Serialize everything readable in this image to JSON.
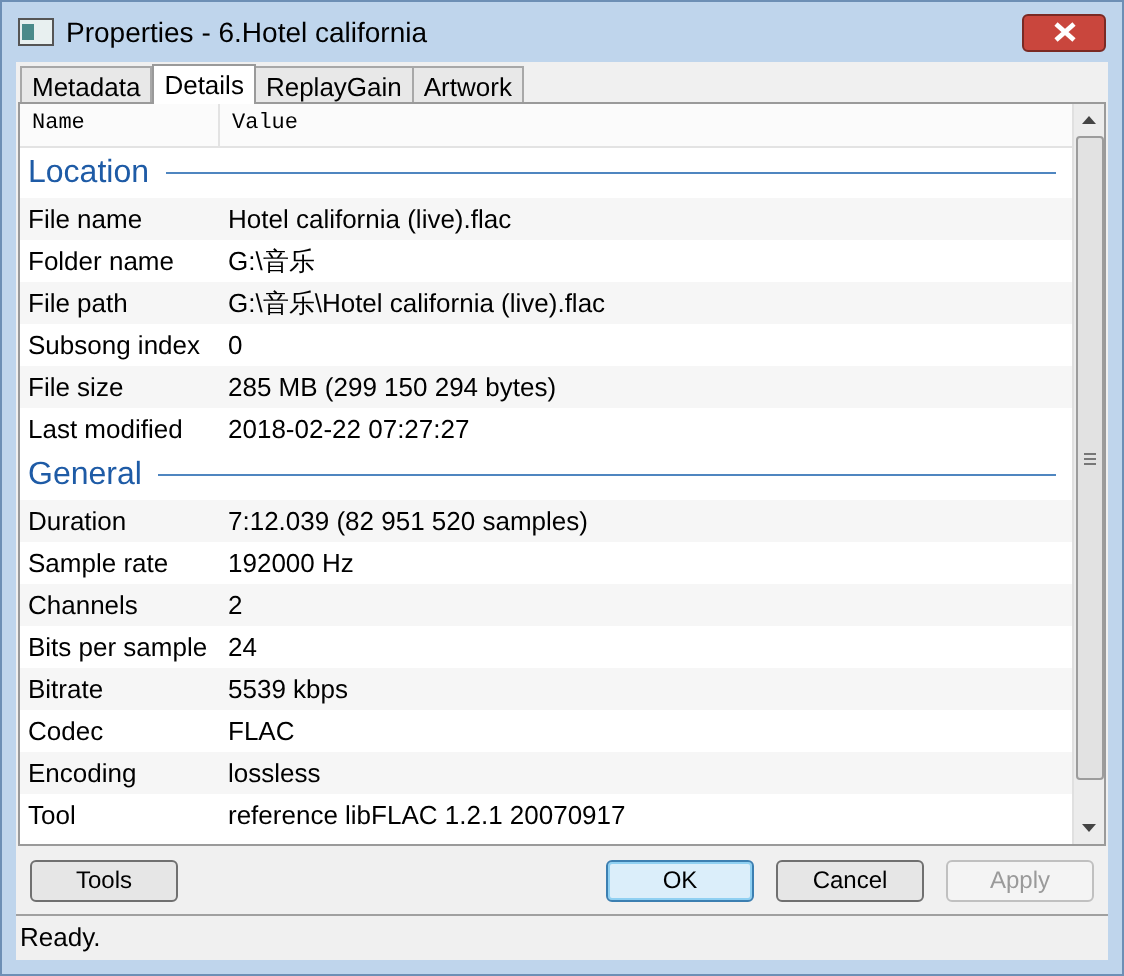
{
  "window": {
    "title": "Properties - 6.Hotel california"
  },
  "tabs": [
    {
      "label": "Metadata",
      "selected": false
    },
    {
      "label": "Details",
      "selected": true
    },
    {
      "label": "ReplayGain",
      "selected": false
    },
    {
      "label": "Artwork",
      "selected": false
    }
  ],
  "table": {
    "columns": [
      "Name",
      "Value"
    ],
    "groups": [
      {
        "title": "Location",
        "rows": [
          {
            "name": "File name",
            "value": "Hotel california (live).flac"
          },
          {
            "name": "Folder name",
            "value": "G:\\音乐"
          },
          {
            "name": "File path",
            "value": "G:\\音乐\\Hotel california (live).flac"
          },
          {
            "name": "Subsong index",
            "value": "0"
          },
          {
            "name": "File size",
            "value": "285 MB (299 150 294 bytes)"
          },
          {
            "name": "Last modified",
            "value": "2018-02-22 07:27:27"
          }
        ]
      },
      {
        "title": "General",
        "rows": [
          {
            "name": "Duration",
            "value": "7:12.039 (82 951 520 samples)"
          },
          {
            "name": "Sample rate",
            "value": "192000 Hz"
          },
          {
            "name": "Channels",
            "value": "2"
          },
          {
            "name": "Bits per sample",
            "value": "24"
          },
          {
            "name": "Bitrate",
            "value": "5539 kbps"
          },
          {
            "name": "Codec",
            "value": "FLAC"
          },
          {
            "name": "Encoding",
            "value": "lossless"
          },
          {
            "name": "Tool",
            "value": "reference libFLAC 1.2.1 20070917"
          }
        ]
      }
    ]
  },
  "buttons": [
    {
      "label": "Tools",
      "default": false,
      "disabled": false
    },
    {
      "label": "OK",
      "default": true,
      "disabled": false
    },
    {
      "label": "Cancel",
      "default": false,
      "disabled": false
    },
    {
      "label": "Apply",
      "default": false,
      "disabled": true
    }
  ],
  "status_bar": "Ready."
}
